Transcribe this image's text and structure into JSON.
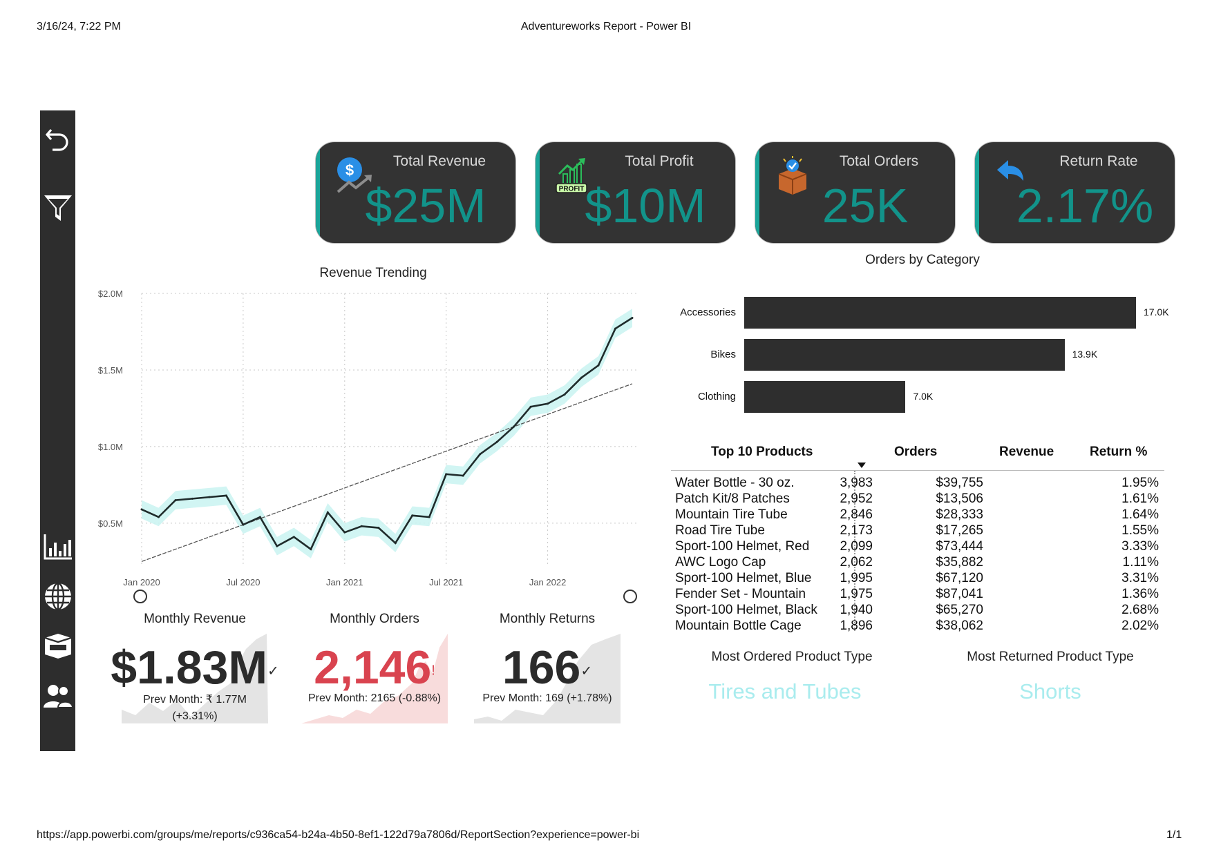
{
  "print_header": {
    "datetime": "3/16/24, 7:22 PM",
    "title": "Adventureworks Report - Power BI"
  },
  "print_footer": {
    "url": "https://app.powerbi.com/groups/me/reports/c936ca54-b24a-4b50-8ef1-122d79a7806d/ReportSection?experience=power-bi",
    "page": "1/1"
  },
  "nav": {
    "icons": [
      "back-arrow-icon",
      "filter-icon",
      "bar-chart-icon",
      "globe-icon",
      "product-box-icon",
      "customers-icon"
    ]
  },
  "kpis": [
    {
      "label": "Total Revenue",
      "value": "$25M",
      "icon": "revenue-dollar-icon"
    },
    {
      "label": "Total Profit",
      "value": "$10M",
      "icon": "profit-chart-icon",
      "badge": "PROFIT"
    },
    {
      "label": "Total Orders",
      "value": "25K",
      "icon": "order-box-icon"
    },
    {
      "label": "Return Rate",
      "value": "2.17%",
      "icon": "return-arrow-icon"
    }
  ],
  "colors": {
    "accent": "#1aa59a",
    "kpi_value": "#12938a",
    "card_bg": "#333333",
    "band": "#c9f3f1",
    "negative": "#d9434f",
    "product_type": "#a9ecee"
  },
  "revenue_trend": {
    "title": "Revenue Trending",
    "chart_data": {
      "type": "line",
      "title": "Revenue Trending",
      "x": [
        "2020-01",
        "2020-02",
        "2020-03",
        "2020-04",
        "2020-05",
        "2020-06",
        "2020-07",
        "2020-08",
        "2020-09",
        "2020-10",
        "2020-11",
        "2020-12",
        "2021-01",
        "2021-02",
        "2021-03",
        "2021-04",
        "2021-05",
        "2021-06",
        "2021-07",
        "2021-08",
        "2021-09",
        "2021-10",
        "2021-11",
        "2021-12",
        "2022-01",
        "2022-02",
        "2022-03",
        "2022-04",
        "2022-05",
        "2022-06"
      ],
      "series": [
        {
          "values": [
            0.59,
            0.54,
            0.65,
            0.66,
            0.67,
            0.68,
            0.49,
            0.54,
            0.35,
            0.41,
            0.33,
            0.57,
            0.44,
            0.48,
            0.47,
            0.37,
            0.55,
            0.54,
            0.82,
            0.81,
            0.95,
            1.03,
            1.13,
            1.26,
            1.28,
            1.34,
            1.45,
            1.53,
            1.77,
            1.84
          ]
        },
        {
          "values": [
            0.25,
            0.29,
            0.33,
            0.37,
            0.41,
            0.45,
            0.49,
            0.53,
            0.57,
            0.61,
            0.65,
            0.69,
            0.73,
            0.77,
            0.81,
            0.85,
            0.89,
            0.93,
            0.97,
            1.01,
            1.05,
            1.09,
            1.13,
            1.17,
            1.21,
            1.25,
            1.29,
            1.33,
            1.37,
            1.41
          ]
        }
      ],
      "x_ticks": [
        "Jan 2020",
        "Jul 2020",
        "Jan 2021",
        "Jul 2021",
        "Jan 2022"
      ],
      "y_ticks": [
        "$0.5M",
        "$1.0M",
        "$1.5M",
        "$2.0M"
      ],
      "ylim": [
        0.22,
        2.0
      ],
      "grid": true
    }
  },
  "orders_by_category": {
    "title": "Orders by Category",
    "chart_data": {
      "type": "bar",
      "orientation": "horizontal",
      "title": "Orders by Category",
      "categories": [
        "Accessories",
        "Bikes",
        "Clothing"
      ],
      "values": [
        17.0,
        13.9,
        7.0
      ],
      "value_labels": [
        "17.0K",
        "13.9K",
        "7.0K"
      ],
      "xlim": [
        0,
        17.0
      ]
    }
  },
  "top_products": {
    "headers": [
      "Top 10 Products",
      "Orders",
      "Revenue",
      "Return %"
    ],
    "rows": [
      [
        "Water Bottle - 30 oz.",
        "3,983",
        "$39,755",
        "1.95%"
      ],
      [
        "Patch Kit/8 Patches",
        "2,952",
        "$13,506",
        "1.61%"
      ],
      [
        "Mountain Tire Tube",
        "2,846",
        "$28,333",
        "1.64%"
      ],
      [
        "Road Tire Tube",
        "2,173",
        "$17,265",
        "1.55%"
      ],
      [
        "Sport-100 Helmet, Red",
        "2,099",
        "$73,444",
        "3.33%"
      ],
      [
        "AWC Logo Cap",
        "2,062",
        "$35,882",
        "1.11%"
      ],
      [
        "Sport-100 Helmet, Blue",
        "1,995",
        "$67,120",
        "3.31%"
      ],
      [
        "Fender Set - Mountain",
        "1,975",
        "$87,041",
        "1.36%"
      ],
      [
        "Sport-100 Helmet, Black",
        "1,940",
        "$65,270",
        "2.68%"
      ],
      [
        "Mountain Bottle Cage",
        "1,896",
        "$38,062",
        "2.02%"
      ]
    ]
  },
  "monthly": [
    {
      "title": "Monthly Revenue",
      "value": "$1.83M",
      "status": "✓",
      "sub1": "Prev Month: ₹ 1.77M",
      "sub2": "(+3.31%)",
      "color": "#2b2b2b",
      "bg": "#e4e4e4"
    },
    {
      "title": "Monthly Orders",
      "value": "2,146",
      "status": "!",
      "sub1": "Prev Month: 2165 (-0.88%)",
      "sub2": "",
      "color": "#d9434f",
      "bg": "#f8dcdc"
    },
    {
      "title": "Monthly Returns",
      "value": "166",
      "status": "✓",
      "sub1": "Prev Month: 169 (+1.78%)",
      "sub2": "",
      "color": "#2b2b2b",
      "bg": "#e4e4e4"
    }
  ],
  "product_types": [
    {
      "title": "Most Ordered Product Type",
      "value": "Tires and Tubes"
    },
    {
      "title": "Most Returned Product Type",
      "value": "Shorts"
    }
  ]
}
